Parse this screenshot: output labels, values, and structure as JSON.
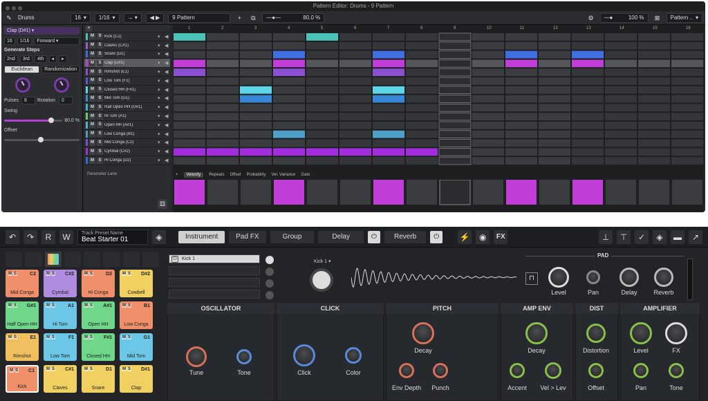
{
  "window_title": "Pattern Editor: Drums - 9 Pattern",
  "toolbar": {
    "kit": "Drums",
    "steps": "16",
    "resolution": "1/16",
    "pattern": "9 Pattern",
    "zoom": "80.0 %",
    "zoom_right": "100 %",
    "pattern_menu": "Pattern .."
  },
  "left_panel": {
    "instrument": "Clap (D#1)",
    "steps": "16",
    "res": "1/16",
    "direction": "Forward",
    "gen_label": "Generate Steps",
    "gen_buttons": [
      "2nd",
      "3rd",
      "4th"
    ],
    "tabs": [
      "Euclidean",
      "Randomization"
    ],
    "pulses_label": "Pulses",
    "pulses_value": "6",
    "rotation_label": "Rotation",
    "rotation_value": "0",
    "swing_label": "Swing",
    "swing_value": "80.0 %",
    "offset_label": "Offset",
    "param_lane": "Parameter Lane"
  },
  "tracks": [
    {
      "name": "Kick (C1)",
      "color": "#4ac3b8"
    },
    {
      "name": "Claves (C#1)",
      "color": "#9b59d6"
    },
    {
      "name": "Snare (D1)",
      "color": "#3f6fe0"
    },
    {
      "name": "Clap (D#1)",
      "color": "#c13fd8"
    },
    {
      "name": "Rimshot (E1)",
      "color": "#8b4fd0"
    },
    {
      "name": "Low Tom (F1)",
      "color": "#5a5ad0"
    },
    {
      "name": "Closed HH (F#1)",
      "color": "#5fd6e6"
    },
    {
      "name": "Mid Tom (G1)",
      "color": "#3a86d8"
    },
    {
      "name": "Half Open HH (G#1)",
      "color": "#3fb0c8"
    },
    {
      "name": "Hi Tom (A1)",
      "color": "#6ad06a"
    },
    {
      "name": "Open HH (A#1)",
      "color": "#4fb5d6"
    },
    {
      "name": "Low Conga (B1)",
      "color": "#4ea0c8"
    },
    {
      "name": "Mid Conga (C2)",
      "color": "#7a4fd0"
    },
    {
      "name": "Cymbal (C#2)",
      "color": "#a22ee0"
    },
    {
      "name": "Hi Conga (D2)",
      "color": "#3a6ad8"
    }
  ],
  "steps": [
    "1",
    "2",
    "3",
    "4",
    "5",
    "6",
    "7",
    "8",
    "9",
    "10",
    "11",
    "12",
    "13",
    "14",
    "15",
    "16"
  ],
  "lane_tabs": [
    "Velocity",
    "Repeats",
    "Offset",
    "Probability",
    "Vel. Variance",
    "Gate"
  ],
  "instrument": {
    "preset_label": "Track Preset Name",
    "preset_name": "Beat Starter 01",
    "tabs": [
      "Instrument",
      "Pad FX",
      "Group",
      "Delay",
      "Reverb"
    ],
    "fx": "FX",
    "sample_name": "Kick 1",
    "layer1": "Kick 1",
    "pad_header": "PAD",
    "pad_knobs": [
      "Level",
      "Pan",
      "Delay",
      "Reverb"
    ],
    "sections": {
      "osc": "OSCILLATOR",
      "click": "CLICK",
      "pitch": "PITCH",
      "ampenv": "AMP ENV",
      "dist": "DIST",
      "amp": "AMPLIFIER"
    },
    "knobs": {
      "tune": "Tune",
      "tone1": "Tone",
      "click": "Click",
      "color": "Color",
      "decay1": "Decay",
      "envdepth": "Env Depth",
      "punch": "Punch",
      "decay2": "Decay",
      "accent": "Accent",
      "vellev": "Vel > Lev",
      "distortion": "Distortion",
      "offset": "Offset",
      "level": "Level",
      "fx": "FX",
      "pan": "Pan",
      "tone2": "Tone"
    }
  },
  "pads": [
    {
      "name": "Mid Conga",
      "note": "C2",
      "color": "#f0906b"
    },
    {
      "name": "Cymbal",
      "note": "C#2",
      "color": "#b08ce0"
    },
    {
      "name": "Hi Conga",
      "note": "D2",
      "color": "#f0906b"
    },
    {
      "name": "Cowbell",
      "note": "D#2",
      "color": "#f0d060"
    },
    {
      "name": "Half Open HH",
      "note": "G#1",
      "color": "#6fd68a"
    },
    {
      "name": "Hi Tom",
      "note": "A1",
      "color": "#6cc6e6"
    },
    {
      "name": "Open HH",
      "note": "A#1",
      "color": "#6fd68a"
    },
    {
      "name": "Low Conga",
      "note": "B1",
      "color": "#f0906b"
    },
    {
      "name": "Rimshot",
      "note": "E1",
      "color": "#f0c060"
    },
    {
      "name": "Low Tom",
      "note": "F1",
      "color": "#6cc6e6"
    },
    {
      "name": "Closed HH",
      "note": "F#1",
      "color": "#6fd68a"
    },
    {
      "name": "Mid Tom",
      "note": "G1",
      "color": "#6cc6e6"
    },
    {
      "name": "Kick",
      "note": "C1",
      "color": "#f0906b"
    },
    {
      "name": "Claves",
      "note": "C#1",
      "color": "#f0d060"
    },
    {
      "name": "Snare",
      "note": "D1",
      "color": "#f0d060"
    },
    {
      "name": "Clap",
      "note": "D#1",
      "color": "#f0d060"
    }
  ]
}
